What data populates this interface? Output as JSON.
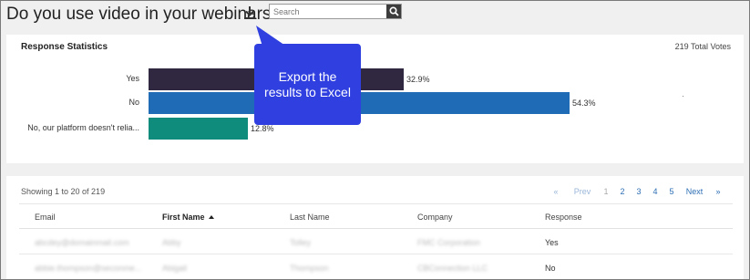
{
  "header": {
    "title": "Do you use video in your webinars?",
    "search_placeholder": "Search"
  },
  "stats": {
    "title": "Response Statistics",
    "total_votes": "219 Total Votes",
    "bars": [
      {
        "label": "Yes",
        "percent_text": "32.9%",
        "percent": 32.9,
        "color": "#2f2840"
      },
      {
        "label": "No",
        "percent_text": "54.3%",
        "percent": 54.3,
        "color": "#1f6bb5"
      },
      {
        "label": "No, our platform doesn't relia...",
        "percent_text": "12.8%",
        "percent": 12.8,
        "color": "#0f8c7c"
      }
    ]
  },
  "callout": {
    "text": "Export the results to Excel",
    "color": "#2f3fe0"
  },
  "list": {
    "showing": "Showing 1 to 20 of 219",
    "pager": {
      "first": "«",
      "prev": "Prev",
      "pages": [
        "1",
        "2",
        "3",
        "4",
        "5"
      ],
      "next": "Next",
      "last": "»"
    },
    "columns": [
      "Email",
      "First Name",
      "Last Name",
      "Company",
      "Response"
    ],
    "rows": [
      [
        "abcdey@domainmail.com",
        "Abby",
        "Tolley",
        "FMC Corporation",
        "Yes"
      ],
      [
        "abbie.thompson@seconme...",
        "Abigail",
        "Thompson",
        "CBConnection LLC",
        "No"
      ]
    ]
  }
}
